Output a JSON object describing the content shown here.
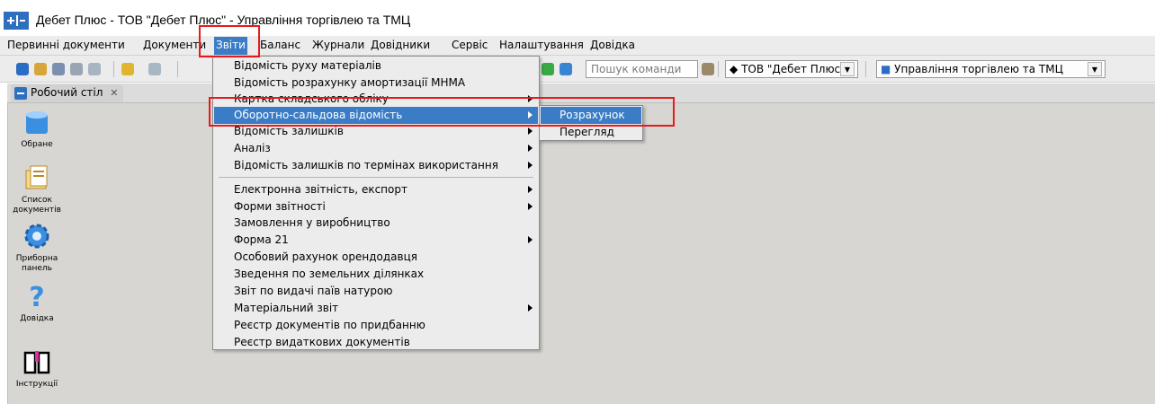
{
  "window": {
    "title": "Дебет Плюс - ТОВ \"Дебет Плюс\" - Управління торгівлею та ТМЦ",
    "icon": "app-logo-icon"
  },
  "menubar": {
    "items": [
      {
        "label": "Первинні документи"
      },
      {
        "label": "Документи"
      },
      {
        "label": "Звіти",
        "active": true
      },
      {
        "label": "Баланс"
      },
      {
        "label": "Журнали"
      },
      {
        "label": "Довідники"
      },
      {
        "label": "Сервіс"
      },
      {
        "label": "Налаштування"
      },
      {
        "label": "Довідка"
      }
    ]
  },
  "toolbar": {
    "search_placeholder": "Пошук команди",
    "company_combo": "ТОВ \"Дебет Плюс\"",
    "module_combo": "Управління торгівлею та ТМЦ"
  },
  "workspace": {
    "tab_label": "Робочий стіл",
    "tab_close": "✕",
    "icons": [
      {
        "label": "Обране",
        "icon": "folder-box-icon"
      },
      {
        "label": "Список документів",
        "icon": "document-list-icon"
      },
      {
        "label": "Приборна панель",
        "icon": "gear-icon"
      },
      {
        "label": "Довідка",
        "icon": "question-mark-icon"
      },
      {
        "label": "Інструкції",
        "icon": "book-icon"
      }
    ]
  },
  "reports_menu": {
    "items": [
      {
        "label": "Відомість руху матеріалів",
        "submenu": false
      },
      {
        "label": "Відомість розрахунку амортизації МНМА",
        "submenu": false
      },
      {
        "label": "Картка складського обліку",
        "submenu": true
      },
      {
        "label": "Оборотно-сальдова відомість",
        "submenu": true,
        "highlighted": true
      },
      {
        "label": "Відомість залишків",
        "submenu": true
      },
      {
        "label": "Аналіз",
        "submenu": true
      },
      {
        "label": "Відомість залишків по термінах використання",
        "submenu": true
      },
      {
        "label": "Електронна звітність, експорт",
        "submenu": true
      },
      {
        "label": "Форми звітності",
        "submenu": true
      },
      {
        "label": "Замовлення у виробництво",
        "submenu": false
      },
      {
        "label": "Форма 21",
        "submenu": true
      },
      {
        "label": "Особовий рахунок орендодавця",
        "submenu": false
      },
      {
        "label": "Зведення по земельних ділянках",
        "submenu": false
      },
      {
        "label": "Звіт по видачі паїв натурою",
        "submenu": false
      },
      {
        "label": "Матеріальний звіт",
        "submenu": true
      },
      {
        "label": "Реєстр документів по придбанню",
        "submenu": false
      },
      {
        "label": "Реєстр видаткових документів",
        "submenu": false
      }
    ]
  },
  "turnover_submenu": {
    "items": [
      {
        "label": "Розрахунок",
        "highlighted": true
      },
      {
        "label": "Перегляд"
      }
    ]
  },
  "colors": {
    "selection": "#3a7cc6",
    "annotation": "#e8191b"
  }
}
